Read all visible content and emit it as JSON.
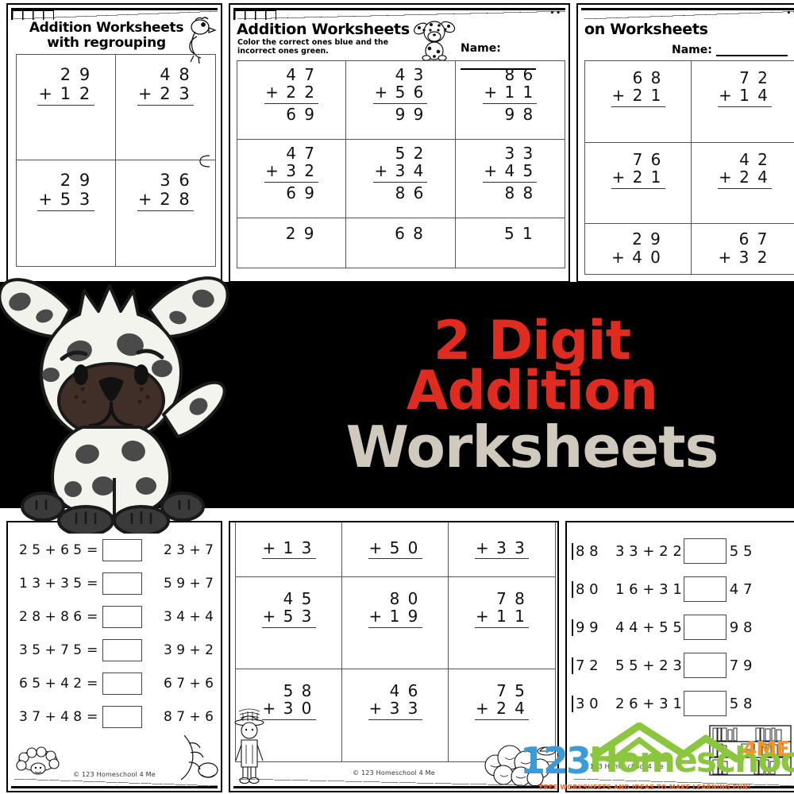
{
  "banner": {
    "line1": "2 Digit",
    "line2": "Addition",
    "line3": "Worksheets",
    "red": "#e02b20",
    "grey": "#cfcabd",
    "background": "#000000"
  },
  "logo": {
    "part1": "123",
    "part2": "Homeschool",
    "part3": "4ME",
    "tagline": "FREE WORKSHEETS AND IDEAS TO MAKE LEARNING FUN!",
    "color1": "#3c9bd6",
    "color2": "#8cc63e",
    "color3": "#f7941e",
    "tagline_color": "#f26522"
  },
  "copyright": "© 123 Homeschool 4 Me",
  "worksheets": {
    "top_left": {
      "title_line1": "Addition Worksheets",
      "title_line2": "with regrouping",
      "clipart": "bird-clipart",
      "problems": [
        [
          {
            "top": "2 9",
            "bot": "1 2",
            "op": "+"
          },
          {
            "top": "4 8",
            "bot": "2 3",
            "op": "+"
          }
        ],
        [
          {
            "top": "2 9",
            "bot": "5 3",
            "op": "+"
          },
          {
            "top": "3 6",
            "bot": "2 8",
            "op": "+"
          }
        ]
      ]
    },
    "top_mid": {
      "title": "Addition Worksheets",
      "subtitle_line1": "Color the correct ones blue and the",
      "subtitle_line2": "incorrect ones green.",
      "name_label": "Name:",
      "clipart": "dalmatian-clipart",
      "problems": [
        [
          {
            "top": "4 7",
            "bot": "2 2",
            "op": "+",
            "sum": "6 9"
          },
          {
            "top": "4 3",
            "bot": "5 6",
            "op": "+",
            "sum": "9 9"
          },
          {
            "top": "8 6",
            "bot": "1 1",
            "op": "+",
            "sum": "9 8"
          }
        ],
        [
          {
            "top": "4 7",
            "bot": "3 2",
            "op": "+",
            "sum": "6 9"
          },
          {
            "top": "5 2",
            "bot": "3 4",
            "op": "+",
            "sum": "8 6"
          },
          {
            "top": "3 3",
            "bot": "4 5",
            "op": "+",
            "sum": "8 8"
          }
        ],
        [
          {
            "top": "2 9",
            "bot": "",
            "op": "",
            "sum": ""
          },
          {
            "top": "6 8",
            "bot": "",
            "op": "",
            "sum": ""
          },
          {
            "top": "5 1",
            "bot": "",
            "op": "",
            "sum": ""
          }
        ]
      ]
    },
    "top_right": {
      "title": "on Worksheets",
      "name_label": "Name:",
      "problems": [
        [
          {
            "top": "6 8",
            "bot": "2 1",
            "op": "+"
          },
          {
            "top": "7 2",
            "bot": "1 4",
            "op": "+"
          }
        ],
        [
          {
            "top": "7 6",
            "bot": "2 1",
            "op": "+"
          },
          {
            "top": "4 2",
            "bot": "2 4",
            "op": "+"
          }
        ],
        [
          {
            "top": "2 9",
            "bot": "4 0",
            "op": "+"
          },
          {
            "top": "6 7",
            "bot": "3 2",
            "op": "+"
          }
        ]
      ]
    },
    "bottom_left": {
      "equals": "=",
      "rows": [
        {
          "left": "2 5 + 6 5",
          "right": "2 3 + 7"
        },
        {
          "left": "1 3 + 3 5",
          "right": "5 9 + 7"
        },
        {
          "left": "2 8 + 8 6",
          "right": "3 4 + 4"
        },
        {
          "left": "3 5 + 7 5",
          "right": "3 9 + 2"
        },
        {
          "left": "6 5 + 4 2",
          "right": "6 7 + 6"
        },
        {
          "left": "3 7 + 4 8",
          "right": "8 7 + 6"
        }
      ],
      "clipart_left": "lamb-clipart",
      "clipart_right": "leaf-clipart"
    },
    "bottom_mid": {
      "problems": [
        [
          {
            "top": "",
            "bot": "1 3",
            "op": "+"
          },
          {
            "top": "",
            "bot": "5 0",
            "op": "+"
          },
          {
            "top": "",
            "bot": "3 3",
            "op": "+"
          }
        ],
        [
          {
            "top": "4 5",
            "bot": "5 3",
            "op": "+"
          },
          {
            "top": "8 0",
            "bot": "1 9",
            "op": "+"
          },
          {
            "top": "7 8",
            "bot": "1 1",
            "op": "+"
          }
        ],
        [
          {
            "top": "5 8",
            "bot": "3 0",
            "op": "+"
          },
          {
            "top": "4 6",
            "bot": "3 3",
            "op": "+"
          },
          {
            "top": "7 5",
            "bot": "2 4",
            "op": "+"
          }
        ]
      ],
      "clipart_left": "boy-gardener-clipart",
      "clipart_right": "bush-clipart"
    },
    "bottom_right": {
      "rows": [
        {
          "cut": "8 8",
          "expr": "3 3 + 2 2",
          "after": "5 5"
        },
        {
          "cut": "8 0",
          "expr": "1 6 + 3 1",
          "after": "4 7"
        },
        {
          "cut": "9 9",
          "expr": "4 4 + 5 5",
          "after": "9 8"
        },
        {
          "cut": "7 2",
          "expr": "5 5 + 2 3",
          "after": "7 9"
        },
        {
          "cut": "3 0",
          "expr": "2 6 + 3 1",
          "after": "5 8"
        }
      ],
      "clipart": "bookshelf-clipart"
    }
  }
}
